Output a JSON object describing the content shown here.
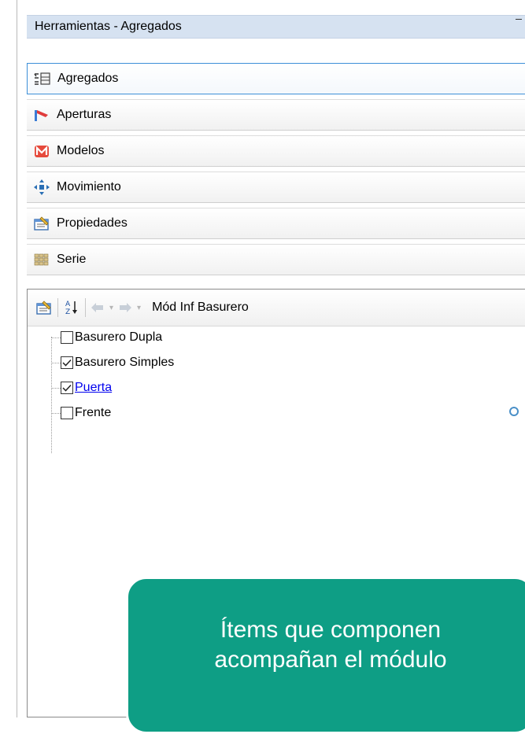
{
  "window": {
    "title": "Herramientas - Agregados"
  },
  "panels": [
    {
      "label": "Agregados",
      "icon": "agregados-icon",
      "selected": true
    },
    {
      "label": "Aperturas",
      "icon": "aperturas-icon",
      "selected": false
    },
    {
      "label": "Modelos",
      "icon": "modelos-icon",
      "selected": false
    },
    {
      "label": "Movimiento",
      "icon": "movimiento-icon",
      "selected": false
    },
    {
      "label": "Propiedades",
      "icon": "propiedades-icon",
      "selected": false
    },
    {
      "label": "Serie",
      "icon": "serie-icon",
      "selected": false
    }
  ],
  "tree_toolbar": {
    "title": "Mód Inf Basurero"
  },
  "tree_items": [
    {
      "label": "Basurero Dupla",
      "checked": false,
      "link": false
    },
    {
      "label": "Basurero Simples",
      "checked": true,
      "link": false
    },
    {
      "label": "Puerta",
      "checked": true,
      "link": true
    },
    {
      "label": "Frente",
      "checked": false,
      "link": false
    }
  ],
  "callout": {
    "line1": "Ítems que componen",
    "line2": "acompañan el módulo"
  },
  "colors": {
    "title_bar": "#d6e2f1",
    "selection_border": "#3c8fd8",
    "callout_bg": "#0e9e85",
    "link": "#0000ee"
  }
}
